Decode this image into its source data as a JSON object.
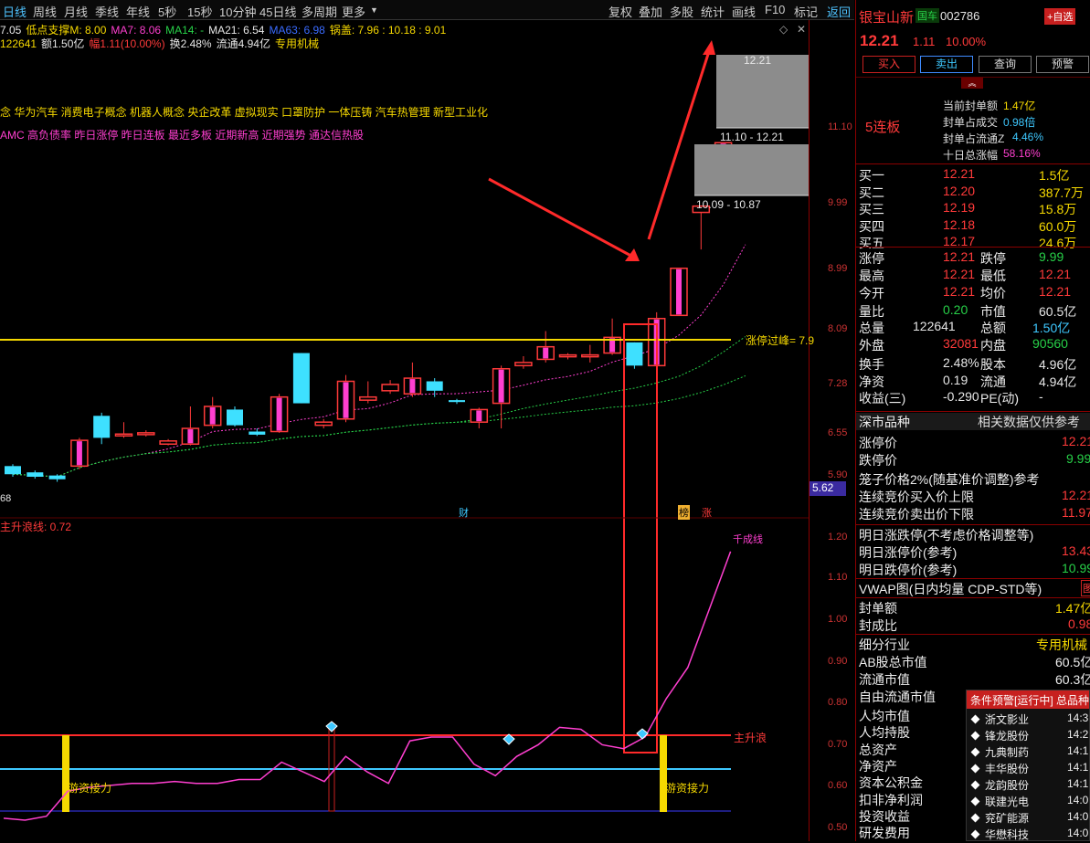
{
  "toolbar": {
    "period_tabs": [
      "日线",
      "周线",
      "月线",
      "季线",
      "年线",
      "5秒",
      "15秒",
      "10分钟",
      "45日线",
      "多周期",
      "更多"
    ],
    "right_buttons": [
      "复权",
      "叠加",
      "多股",
      "统计",
      "画线",
      "F10",
      "标记",
      "返回"
    ]
  },
  "indicators": {
    "line1_segments": [
      {
        "text": "7.05",
        "color": "#e6e6e6"
      },
      {
        "text": "低点支撑M: 8.00",
        "color": "#f5d800"
      },
      {
        "text": "MA7: 8.06",
        "color": "#ff3fd0"
      },
      {
        "text": "MA14: -",
        "color": "#27d048"
      },
      {
        "text": "MA21: 6.54",
        "color": "#e6e6e6"
      },
      {
        "text": "MA63: 6.98",
        "color": "#3a6bff"
      },
      {
        "text": "锅盖: 7.96 : 10.18 : 9.01",
        "color": "#f5d800"
      }
    ],
    "line2_segments": [
      {
        "text": "122641",
        "color": "#f5d800"
      },
      {
        "text": "额1.50亿",
        "color": "#e6e6e6"
      },
      {
        "text": "幅1.11(10.00%)",
        "color": "#ff3a3a"
      },
      {
        "text": "换2.48%",
        "color": "#e6e6e6"
      },
      {
        "text": "流通4.94亿",
        "color": "#e6e6e6"
      },
      {
        "text": "专用机械",
        "color": "#f5d800"
      }
    ],
    "concepts": "念 华为汽车 消费电子概念 机器人概念 央企改革 虚拟现实 口罩防护 一体压铸 汽车热管理 新型工业化",
    "tags": "AMC 高负债率 昨日涨停 昨日连板 最近多板 近期新高 近期强势 通达信热股",
    "sub_title": "主升浪线: 0.72"
  },
  "chart_labels": {
    "box_upper": "11.10 - 12.21",
    "box_lower": "10.09 - 10.87",
    "top_price": "12.21",
    "limit_line": "涨停过峰= 7.9",
    "low_value": "5.62",
    "left_low": "68",
    "marker_cai": "财",
    "marker_bang": "榜",
    "marker_zhang": "涨",
    "main_wave": "主升浪",
    "relay_left": "游资接力",
    "relay_right": "游资接力",
    "sub_top_label": "千成线"
  },
  "price_axis": [
    "11.10",
    "9.99",
    "8.99",
    "8.09",
    "7.28",
    "6.55",
    "5.90",
    "1.20",
    "1.10",
    "1.00",
    "0.90",
    "0.80",
    "0.70",
    "0.60",
    "0.50"
  ],
  "stock": {
    "name": "银宝山新",
    "sector_badge": "国车",
    "code": "002786",
    "fav_button": "+自选",
    "price": "12.21",
    "change": "1.11",
    "change_pct": "10.00%",
    "buttons": [
      "买入",
      "卖出",
      "查询",
      "预警"
    ],
    "streak": "5连板",
    "seal_stats": [
      {
        "label": "当前封单额",
        "value": "1.47亿"
      },
      {
        "label": "封单占成交",
        "value": "0.98倍"
      },
      {
        "label": "封单占流通Z",
        "value": "4.46%"
      },
      {
        "label": "十日总涨幅",
        "value": "58.16%"
      }
    ]
  },
  "order_book": [
    {
      "label": "买一",
      "price": "12.21",
      "vol": "1.5亿"
    },
    {
      "label": "买二",
      "price": "12.20",
      "vol": "387.7万"
    },
    {
      "label": "买三",
      "price": "12.19",
      "vol": "15.8万"
    },
    {
      "label": "买四",
      "price": "12.18",
      "vol": "60.0万"
    },
    {
      "label": "买五",
      "price": "12.17",
      "vol": "24.6万"
    }
  ],
  "quote_rows": [
    {
      "l1": "涨停",
      "v1": "12.21",
      "c1": "#ff3a3a",
      "l2": "跌停",
      "v2": "9.99",
      "c2": "#27d048"
    },
    {
      "l1": "最高",
      "v1": "12.21",
      "c1": "#ff3a3a",
      "l2": "最低",
      "v2": "12.21",
      "c2": "#ff3a3a"
    },
    {
      "l1": "今开",
      "v1": "12.21",
      "c1": "#ff3a3a",
      "l2": "均价",
      "v2": "12.21",
      "c2": "#ff3a3a"
    },
    {
      "l1": "量比",
      "v1": "0.20",
      "c1": "#27d048",
      "l2": "市值",
      "v2": "60.5亿",
      "c2": "#e6e6e6"
    },
    {
      "l1": "总量",
      "v1": "122641",
      "c1": "#e6e6e6",
      "l2": "总额",
      "v2": "1.50亿",
      "c2": "#3ec8ff"
    },
    {
      "l1": "外盘",
      "v1": "32081",
      "c1": "#ff3a3a",
      "l2": "内盘",
      "v2": "90560",
      "c2": "#27d048"
    },
    {
      "l1": "换手",
      "v1": "2.48%",
      "c1": "#e6e6e6",
      "l2": "股本",
      "v2": "4.96亿",
      "c2": "#e6e6e6"
    },
    {
      "l1": "净资",
      "v1": "0.19",
      "c1": "#e6e6e6",
      "l2": "流通",
      "v2": "4.94亿",
      "c2": "#e6e6e6"
    },
    {
      "l1": "收益(三)",
      "v1": "-0.290",
      "c1": "#e6e6e6",
      "l2": "PE(动)",
      "v2": "-",
      "c2": "#e6e6e6"
    }
  ],
  "extra": {
    "market_header": "深市品种",
    "market_header_right": "相关数据仅供参考",
    "limit_up_price_label": "涨停价",
    "limit_up_price": "12.21",
    "limit_down_price_label": "跌停价",
    "limit_down_price": "9.99",
    "cage_label": "笼子价格2%(随基准价调整)参考",
    "auction_buy_label": "连续竞价买入价上限",
    "auction_buy": "12.21",
    "auction_sell_label": "连续竞价卖出价下限",
    "auction_sell": "11.97",
    "tomorrow_header": "明日涨跌停(不考虑价格调整等)",
    "tomorrow_up_label": "明日涨停价(参考)",
    "tomorrow_up": "13.43",
    "tomorrow_down_label": "明日跌停价(参考)",
    "tomorrow_down": "10.99",
    "vwap_label": "VWAP图(日内均量 CDP-STD等)",
    "seal_amount_label": "封单额",
    "seal_amount": "1.47亿",
    "seal_ratio_label": "封成比",
    "seal_ratio": "0.98",
    "industry_label": "细分行业",
    "industry": "专用机械",
    "ab_cap_label": "AB股总市值",
    "ab_cap": "60.5亿",
    "float_cap_label": "流通市值",
    "float_cap": "60.3亿",
    "free_cap_label": "自由流通市值",
    "bottom_labels": [
      "人均市值",
      "人均持股",
      "总资产",
      "净资产",
      "资本公积金",
      "扣非净利润",
      "投资收益",
      "研发费用"
    ]
  },
  "alert": {
    "title": "条件预警[运行中] 总品种",
    "items": [
      {
        "name": "浙文影业",
        "time": "14:3"
      },
      {
        "name": "锋龙股份",
        "time": "14:2"
      },
      {
        "name": "九典制药",
        "time": "14:1"
      },
      {
        "name": "丰华股份",
        "time": "14:1"
      },
      {
        "name": "龙韵股份",
        "time": "14:1"
      },
      {
        "name": "联建光电",
        "time": "14:0"
      },
      {
        "name": "兖矿能源",
        "time": "14:0"
      },
      {
        "name": "华懋科技",
        "time": "14:0"
      }
    ]
  },
  "chart_data": {
    "type": "candlestick",
    "y_range": [
      5.62,
      12.5
    ],
    "candles": [
      {
        "o": 5.95,
        "c": 5.82,
        "h": 5.98,
        "l": 5.78
      },
      {
        "o": 5.85,
        "c": 5.78,
        "h": 5.88,
        "l": 5.75
      },
      {
        "o": 5.8,
        "c": 5.74,
        "h": 5.82,
        "l": 5.7
      },
      {
        "o": 5.95,
        "c": 6.36,
        "h": 6.4,
        "l": 5.9
      },
      {
        "o": 6.75,
        "c": 6.4,
        "h": 6.8,
        "l": 6.3
      },
      {
        "o": 6.44,
        "c": 6.46,
        "h": 6.65,
        "l": 6.4
      },
      {
        "o": 6.46,
        "c": 6.48,
        "h": 6.52,
        "l": 6.42
      },
      {
        "o": 6.3,
        "c": 6.35,
        "h": 6.38,
        "l": 6.28
      },
      {
        "o": 6.3,
        "c": 6.55,
        "h": 6.9,
        "l": 6.28
      },
      {
        "o": 6.6,
        "c": 6.9,
        "h": 7.05,
        "l": 6.55
      },
      {
        "o": 6.85,
        "c": 6.6,
        "h": 6.9,
        "l": 6.58
      },
      {
        "o": 6.5,
        "c": 6.45,
        "h": 6.55,
        "l": 6.43
      },
      {
        "o": 6.5,
        "c": 7.05,
        "h": 7.1,
        "l": 6.48
      },
      {
        "o": 7.75,
        "c": 6.95,
        "h": 7.75,
        "l": 6.95
      },
      {
        "o": 6.6,
        "c": 6.65,
        "h": 6.7,
        "l": 6.55
      },
      {
        "o": 6.7,
        "c": 7.3,
        "h": 7.4,
        "l": 6.65
      },
      {
        "o": 7.0,
        "c": 7.05,
        "h": 7.3,
        "l": 6.95
      },
      {
        "o": 7.15,
        "c": 7.25,
        "h": 7.32,
        "l": 7.1
      },
      {
        "o": 7.1,
        "c": 7.35,
        "h": 7.6,
        "l": 7.05
      },
      {
        "o": 7.3,
        "c": 7.15,
        "h": 7.35,
        "l": 7.05
      },
      {
        "o": 7.0,
        "c": 6.97,
        "h": 7.02,
        "l": 6.94
      },
      {
        "o": 6.65,
        "c": 6.85,
        "h": 6.88,
        "l": 6.55
      },
      {
        "o": 6.95,
        "c": 7.5,
        "h": 7.55,
        "l": 6.55
      },
      {
        "o": 7.55,
        "c": 7.6,
        "h": 7.7,
        "l": 7.5
      },
      {
        "o": 7.65,
        "c": 7.85,
        "h": 8.1,
        "l": 7.6
      },
      {
        "o": 7.7,
        "c": 7.72,
        "h": 7.75,
        "l": 7.65
      },
      {
        "o": 7.7,
        "c": 7.72,
        "h": 7.88,
        "l": 7.6
      },
      {
        "o": 7.75,
        "c": 8.0,
        "h": 8.3,
        "l": 7.72
      },
      {
        "o": 7.92,
        "c": 7.55,
        "h": 7.92,
        "l": 7.5
      },
      {
        "o": 7.55,
        "c": 8.3,
        "h": 8.4,
        "l": 7.5
      },
      {
        "o": 8.35,
        "c": 9.1,
        "h": 9.1,
        "l": 8.95
      },
      {
        "o": 9.99,
        "c": 10.09,
        "h": 10.09,
        "l": 9.4
      },
      {
        "o": 10.87,
        "c": 11.1,
        "h": 11.1,
        "l": 10.87
      },
      {
        "o": 12.21,
        "c": 12.21,
        "h": 12.21,
        "l": 12.21
      }
    ],
    "sub_series": [
      0.51,
      0.505,
      0.515,
      0.58,
      0.59,
      0.595,
      0.6,
      0.6,
      0.605,
      0.6,
      0.6,
      0.61,
      0.61,
      0.655,
      0.63,
      0.605,
      0.67,
      0.63,
      0.6,
      0.71,
      0.72,
      0.72,
      0.65,
      0.62,
      0.67,
      0.7,
      0.745,
      0.74,
      0.7,
      0.69,
      0.72,
      0.82,
      0.9,
      1.05,
      1.2
    ],
    "sub_range": [
      0.46,
      1.24
    ]
  }
}
